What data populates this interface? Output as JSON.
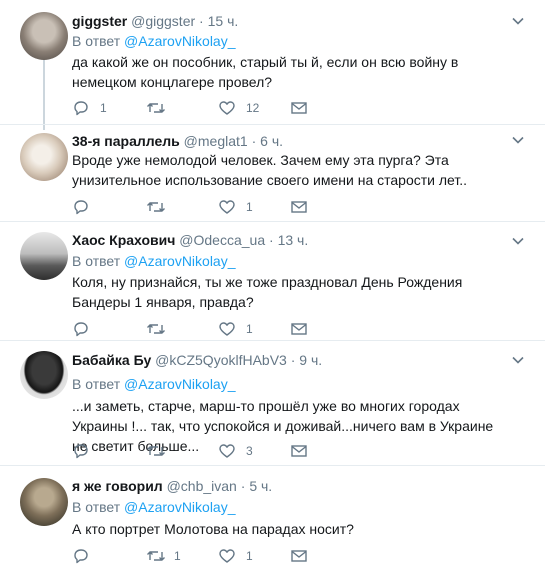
{
  "reply_prefix": "В ответ",
  "tweets": [
    {
      "name": "giggster",
      "handle": "@giggster",
      "time": "15 ч.",
      "reply_to": "@AzarovNikolay_",
      "text": "да какой же он пособник, старый ты   й, если он всю войну в немецком концлагере провел?",
      "replies": "1",
      "retweets": "",
      "likes": "12"
    },
    {
      "name": "38-я параллель",
      "handle": "@meglat1",
      "time": "6 ч.",
      "reply_to": "",
      "text": "Вроде уже немолодой человек. Зачем ему эта пурга? Эта унизительное использование своего имени на старости лет..",
      "replies": "",
      "retweets": "",
      "likes": "1"
    },
    {
      "name": "Хаос Крахович",
      "handle": "@Odecca_ua",
      "time": "13 ч.",
      "reply_to": "@AzarovNikolay_",
      "text": "Коля, ну признайся, ты же тоже праздновал День Рождения Бандеры 1 января,  правда?",
      "replies": "",
      "retweets": "",
      "likes": "1"
    },
    {
      "name": "Бабайка Бу",
      "handle": "@kCZ5QyoklfHAbV3",
      "time": "9 ч.",
      "reply_to": "@AzarovNikolay_",
      "text": "...и заметь, старче, марш-то прошёл уже во многих городах Украины !... так, что успокойся и доживай...ничего вам в Украине не светит больше...",
      "replies": "",
      "retweets": "",
      "likes": "3"
    },
    {
      "name": "я же говорил",
      "handle": "@chb_ivan",
      "time": "5 ч.",
      "reply_to": "@AzarovNikolay_",
      "text": "А кто портрет Молотова на парадах носит?",
      "replies": "",
      "retweets": "1",
      "likes": "1"
    }
  ],
  "colors": {
    "link": "#1da1f2",
    "muted": "#657786",
    "text": "#14171a",
    "divider": "#e6ecf0"
  },
  "icons": [
    "reply-icon",
    "retweet-icon",
    "like-icon",
    "message-icon",
    "chevron-down-icon"
  ]
}
